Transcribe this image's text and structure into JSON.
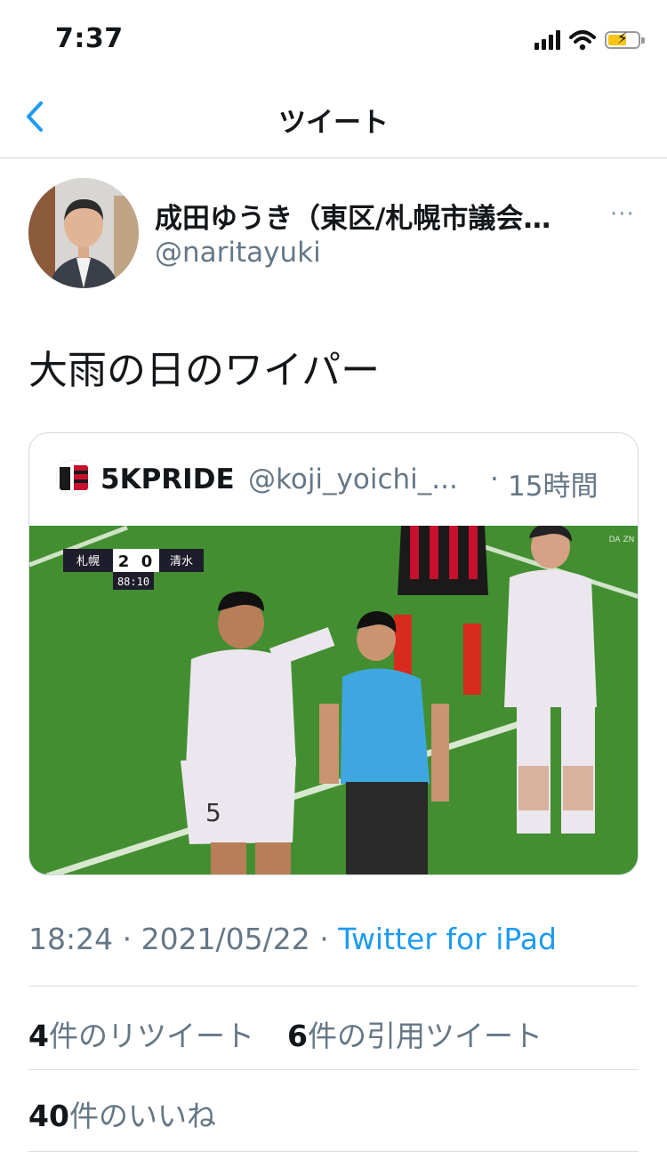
{
  "status_bar": {
    "time": "7:37"
  },
  "nav": {
    "title": "ツイート"
  },
  "tweet": {
    "display_name": "成田ゆうき（東区/札幌市議会…",
    "handle": "@naritayuki",
    "more": "···",
    "text": "大雨の日のワイパー",
    "quoted": {
      "name": "5KPRIDE",
      "handle": "@koji_yoichi_...",
      "separator": "·",
      "time": "15時間",
      "scoreboard": {
        "home": "札幌",
        "score_home": "2",
        "score_away": "0",
        "away": "清水",
        "clock": "88:10",
        "broadcaster": "DA ZN"
      },
      "player_number": "5"
    },
    "timestamp": "18:24 · 2021/05/22 · ",
    "source": "Twitter for iPad",
    "retweet_count": "4",
    "retweet_label": "件のリツイート",
    "quote_count": "6",
    "quote_label": "件の引用ツイート",
    "like_count": "40",
    "like_label": "件のいいね"
  },
  "colors": {
    "link": "#1d9bf0",
    "secondary_text": "#657786",
    "pitch": "#3f8a2e",
    "referee_shirt": "#3fa7e0"
  }
}
